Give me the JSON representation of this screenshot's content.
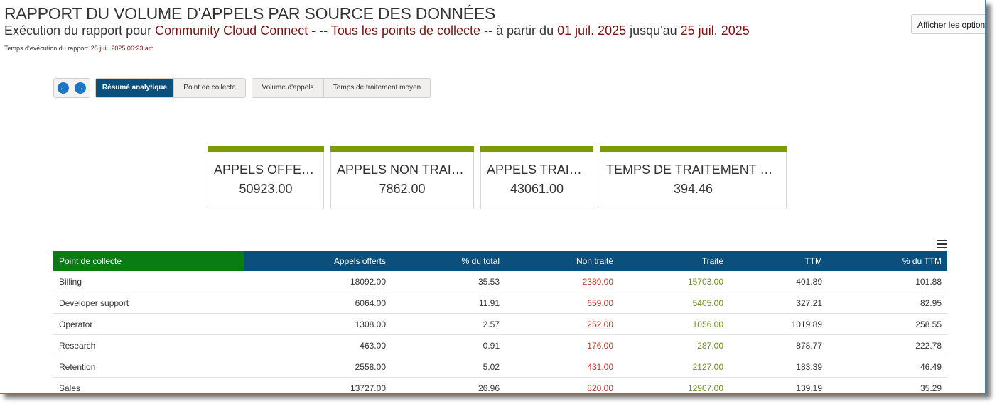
{
  "header": {
    "title": "RAPPORT DU VOLUME D'APPELS PAR SOURCE DES DONNÉES",
    "subtitle_prefix": "Exécution du rapport pour ",
    "tenant": "Community Cloud Connect",
    "scope": " - -- Tous les points de collecte --",
    "from_label": "  à partir du ",
    "start_date": "01 juil. 2025",
    "to_label": " jusqu'au ",
    "end_date": "25 juil. 2025",
    "exec_time_label": "Temps d'exécution du rapport",
    "exec_time_value": "25 juil. 2025 06:23 am",
    "options_button": "Afficher les options"
  },
  "toolbar": {
    "back_icon": "arrow-left-icon",
    "forward_icon": "arrow-right-icon",
    "view_tabs": [
      {
        "label": "Résumé analytique",
        "active": true
      },
      {
        "label": "Point de collecte",
        "active": false
      }
    ],
    "metric_tabs": [
      {
        "label": "Volume d'appels"
      },
      {
        "label": "Temps de traitement moyen"
      }
    ]
  },
  "kpis": [
    {
      "label": "APPELS OFFERTS",
      "value": "50923.00"
    },
    {
      "label": "APPELS NON TRAITÉS",
      "value": "7862.00"
    },
    {
      "label": "APPELS TRAITÉS",
      "value": "43061.00"
    },
    {
      "label": "TEMPS DE TRAITEMENT MOYEN",
      "value": "394.46"
    }
  ],
  "colors": {
    "accent_bar": "#7a9a0a",
    "header_blue": "#0b4f7c",
    "header_green": "#0a7d12",
    "untreated_red": "#c0392b",
    "treated_green": "#6b8e23"
  },
  "table": {
    "menu_icon": "hamburger-menu-icon",
    "columns": [
      "Point de collecte",
      "Appels offerts",
      "% du total",
      "Non traité",
      "Traité",
      "TTM",
      "% du TTM"
    ],
    "rows": [
      [
        "Billing",
        "18092.00",
        "35.53",
        "2389.00",
        "15703.00",
        "401.89",
        "101.88"
      ],
      [
        "Developer support",
        "6064.00",
        "11.91",
        "659.00",
        "5405.00",
        "327.21",
        "82.95"
      ],
      [
        "Operator",
        "1308.00",
        "2.57",
        "252.00",
        "1056.00",
        "1019.89",
        "258.55"
      ],
      [
        "Research",
        "463.00",
        "0.91",
        "176.00",
        "287.00",
        "878.77",
        "222.78"
      ],
      [
        "Retention",
        "2558.00",
        "5.02",
        "431.00",
        "2127.00",
        "183.39",
        "46.49"
      ],
      [
        "Sales",
        "13727.00",
        "26.96",
        "820.00",
        "12907.00",
        "139.19",
        "35.29"
      ]
    ]
  }
}
